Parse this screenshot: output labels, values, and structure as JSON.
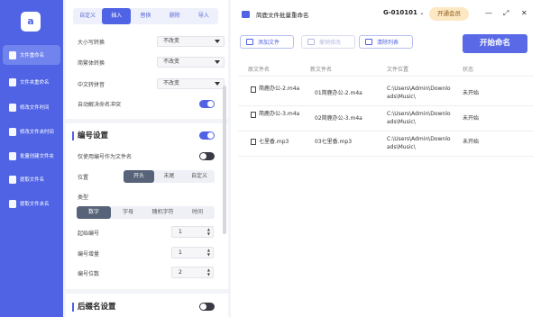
{
  "sidebar": {
    "logo": "a",
    "items": [
      {
        "label": "文件重命名",
        "active": true
      },
      {
        "label": "文件夹重命名",
        "active": false
      },
      {
        "label": "修改文件时间",
        "active": false
      },
      {
        "label": "修改文件夹时间",
        "active": false
      },
      {
        "label": "批量创建文件夹",
        "active": false
      },
      {
        "label": "提取文件名",
        "active": false
      },
      {
        "label": "提取文件夹名",
        "active": false
      }
    ]
  },
  "panel": {
    "tabs": [
      "自定义",
      "插入",
      "替换",
      "删除",
      "导入"
    ],
    "active_tab": "插入",
    "case_convert": {
      "label": "大小写转换",
      "value": "不改变"
    },
    "simp_trad_convert": {
      "label": "简繁体转换",
      "value": "不改变"
    },
    "pinyin_convert": {
      "label": "中文转拼音",
      "value": "不改变"
    },
    "auto_resolve": {
      "label": "自动解决命名冲突",
      "on": true
    },
    "numbering": {
      "title": "编号设置",
      "enabled": true,
      "only_number_label": "仅使用编号作为文件名",
      "only_number_on": false,
      "position_label": "位置",
      "position_options": [
        "开头",
        "末尾",
        "自定义"
      ],
      "position_selected": "开头",
      "type_label": "类型",
      "type_options": [
        "数字",
        "字母",
        "随机字符",
        "时间"
      ],
      "type_selected": "数字",
      "start_label": "起始编号",
      "start_value": "1",
      "step_label": "编号增量",
      "step_value": "1",
      "digits_label": "编号位数",
      "digits_value": "2"
    },
    "suffix": {
      "title": "后缀名设置",
      "enabled": false
    }
  },
  "main": {
    "title": "简鹿文件批量重命名",
    "account": "G-010101",
    "vip_label": "开通会员",
    "window_controls": [
      "minimize",
      "restore",
      "close"
    ],
    "toolbar": {
      "add_file": "添加文件",
      "undo_modify": "撤销修改",
      "clear_list": "清除列表",
      "start": "开始命名"
    },
    "columns": [
      "原文件名",
      "新文件名",
      "文件位置",
      "状态"
    ],
    "rows": [
      {
        "original": "简鹿办公-2.m4a",
        "new": "01简鹿办公-2.m4a",
        "location": "C:\\Users\\Admin\\Downloads\\Music\\",
        "status": "未开始"
      },
      {
        "original": "简鹿办公-3.m4a",
        "new": "02简鹿办公-3.m4a",
        "location": "C:\\Users\\Admin\\Downloads\\Music\\",
        "status": "未开始"
      },
      {
        "original": "七里香.mp3",
        "new": "03七里香.mp3",
        "location": "C:\\Users\\Admin\\Downloads\\Music\\",
        "status": "未开始"
      }
    ]
  },
  "colors": {
    "accent": "#4f63e4",
    "sidebar_bg": "#4f63e4",
    "vip_bg": "#fde8c4",
    "toggle_off": "#3a3a46"
  }
}
